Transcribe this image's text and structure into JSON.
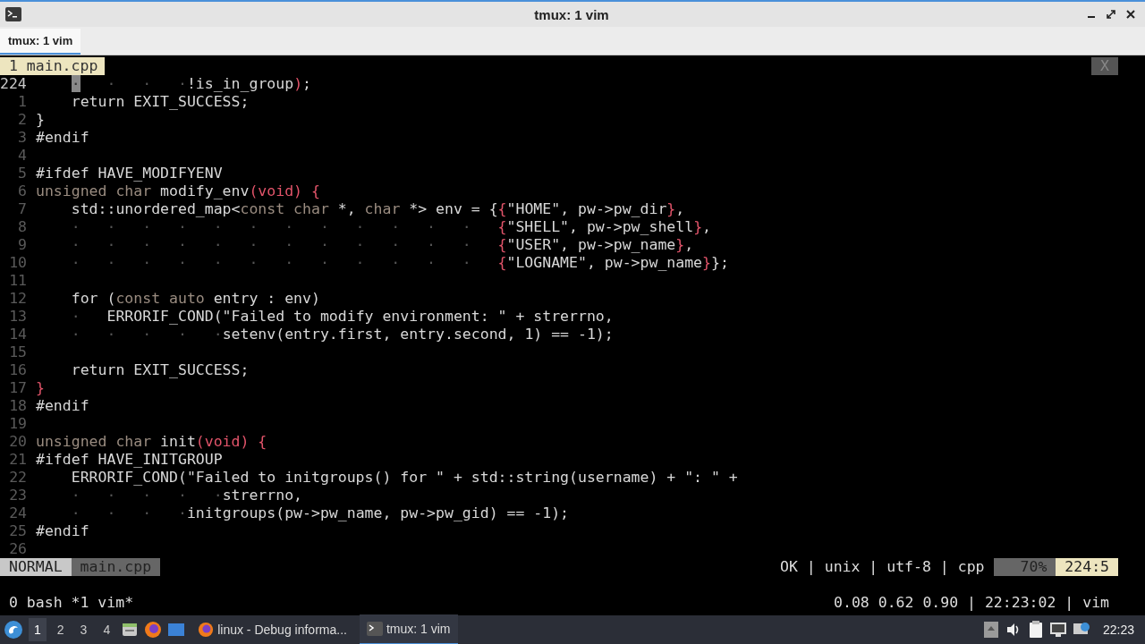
{
  "window": {
    "title": "tmux: 1 vim"
  },
  "tabs": [
    {
      "label": "tmux: 1 vim",
      "selected": true
    }
  ],
  "vim": {
    "tabline": {
      "tabs": [
        {
          "label": "1 main.cpp",
          "selected": true
        }
      ],
      "close": "X"
    },
    "lines": [
      {
        "number": "224",
        "current": true,
        "tokens": [
          {
            "kind": "cursor",
            "text": "    ·"
          },
          {
            "kind": "d",
            "text": "   ·   ·   ·"
          },
          {
            "kind": "n",
            "text": "!is_in_group"
          },
          {
            "kind": "p",
            "text": ")"
          },
          {
            "kind": "n",
            "text": ";"
          }
        ]
      },
      {
        "number": "1",
        "current": false,
        "tokens": [
          {
            "kind": "n",
            "text": "    return EXIT_SUCCESS;"
          }
        ]
      },
      {
        "number": "2",
        "current": false,
        "tokens": [
          {
            "kind": "n",
            "text": "}"
          }
        ]
      },
      {
        "number": "3",
        "current": false,
        "tokens": [
          {
            "kind": "n",
            "text": "#endif"
          }
        ]
      },
      {
        "number": "4",
        "current": false
      },
      {
        "number": "5",
        "current": false,
        "tokens": [
          {
            "kind": "n",
            "text": "#ifdef HAVE_MODIFYENV"
          }
        ]
      },
      {
        "number": "6",
        "current": false,
        "tokens": [
          {
            "kind": "k",
            "text": "unsigned char"
          },
          {
            "kind": "n",
            "text": " modify_env"
          },
          {
            "kind": "p",
            "text": "(void) {"
          }
        ]
      },
      {
        "number": "7",
        "current": false,
        "tokens": [
          {
            "kind": "n",
            "text": "    std::unordered_map<"
          },
          {
            "kind": "k",
            "text": "const char"
          },
          {
            "kind": "n",
            "text": " *, "
          },
          {
            "kind": "k",
            "text": "char"
          },
          {
            "kind": "n",
            "text": " *> env = {"
          },
          {
            "kind": "p",
            "text": "{"
          },
          {
            "kind": "n",
            "text": "\"HOME\", pw->pw_dir"
          },
          {
            "kind": "p",
            "text": "}"
          },
          {
            "kind": "n",
            "text": ","
          }
        ]
      },
      {
        "number": "8",
        "current": false,
        "tokens": [
          {
            "kind": "d",
            "text": "    ·   ·   ·   ·   ·   ·   ·   ·   ·   ·   ·   ·   "
          },
          {
            "kind": "p",
            "text": "{"
          },
          {
            "kind": "n",
            "text": "\"SHELL\", pw->pw_shell"
          },
          {
            "kind": "p",
            "text": "}"
          },
          {
            "kind": "n",
            "text": ","
          }
        ]
      },
      {
        "number": "9",
        "current": false,
        "tokens": [
          {
            "kind": "d",
            "text": "    ·   ·   ·   ·   ·   ·   ·   ·   ·   ·   ·   ·   "
          },
          {
            "kind": "p",
            "text": "{"
          },
          {
            "kind": "n",
            "text": "\"USER\", pw->pw_name"
          },
          {
            "kind": "p",
            "text": "}"
          },
          {
            "kind": "n",
            "text": ","
          }
        ]
      },
      {
        "number": "10",
        "current": false,
        "tokens": [
          {
            "kind": "d",
            "text": "    ·   ·   ·   ·   ·   ·   ·   ·   ·   ·   ·   ·   "
          },
          {
            "kind": "p",
            "text": "{"
          },
          {
            "kind": "n",
            "text": "\"LOGNAME\", pw->pw_name"
          },
          {
            "kind": "p",
            "text": "}"
          },
          {
            "kind": "n",
            "text": "};"
          }
        ]
      },
      {
        "number": "11",
        "current": false
      },
      {
        "number": "12",
        "current": false,
        "tokens": [
          {
            "kind": "n",
            "text": "    for ("
          },
          {
            "kind": "k",
            "text": "const auto"
          },
          {
            "kind": "n",
            "text": " entry : env)"
          }
        ]
      },
      {
        "number": "13",
        "current": false,
        "tokens": [
          {
            "kind": "d",
            "text": "    ·   "
          },
          {
            "kind": "n",
            "text": "ERRORIF_COND(\"Failed to modify environment: \" + strerrno,"
          }
        ]
      },
      {
        "number": "14",
        "current": false,
        "tokens": [
          {
            "kind": "d",
            "text": "    ·   ·   ·   ·   ·"
          },
          {
            "kind": "n",
            "text": "setenv(entry.first, entry.second, 1) == -1);"
          }
        ]
      },
      {
        "number": "15",
        "current": false
      },
      {
        "number": "16",
        "current": false,
        "tokens": [
          {
            "kind": "n",
            "text": "    return EXIT_SUCCESS;"
          }
        ]
      },
      {
        "number": "17",
        "current": false,
        "tokens": [
          {
            "kind": "p",
            "text": "}"
          }
        ]
      },
      {
        "number": "18",
        "current": false,
        "tokens": [
          {
            "kind": "n",
            "text": "#endif"
          }
        ]
      },
      {
        "number": "19",
        "current": false
      },
      {
        "number": "20",
        "current": false,
        "tokens": [
          {
            "kind": "k",
            "text": "unsigned char"
          },
          {
            "kind": "n",
            "text": " init"
          },
          {
            "kind": "p",
            "text": "(void) {"
          }
        ]
      },
      {
        "number": "21",
        "current": false,
        "tokens": [
          {
            "kind": "n",
            "text": "#ifdef HAVE_INITGROUP"
          }
        ]
      },
      {
        "number": "22",
        "current": false,
        "tokens": [
          {
            "kind": "n",
            "text": "    ERRORIF_COND(\"Failed to initgroups() for \" + std::string(username) + \": \" +"
          }
        ]
      },
      {
        "number": "23",
        "current": false,
        "tokens": [
          {
            "kind": "d",
            "text": "    ·   ·   ·   ·   ·"
          },
          {
            "kind": "n",
            "text": "strerrno,"
          }
        ]
      },
      {
        "number": "24",
        "current": false,
        "tokens": [
          {
            "kind": "d",
            "text": "    ·   ·   ·   ·"
          },
          {
            "kind": "n",
            "text": "initgroups(pw->pw_name, pw->pw_gid) == -1);"
          }
        ]
      },
      {
        "number": "25",
        "current": false,
        "tokens": [
          {
            "kind": "n",
            "text": "#endif"
          }
        ]
      },
      {
        "number": "26",
        "current": false
      }
    ],
    "statusline": {
      "mode": "NORMAL",
      "file": "main.cpp",
      "info": "OK | unix | utf-8 | cpp",
      "percent": "70%",
      "position": "224:5"
    }
  },
  "tmux_status": {
    "windows": "0 bash *1 vim*",
    "right": "0.08 0.62 0.90 | 22:23:02 | vim"
  },
  "taskbar": {
    "workspaces": [
      {
        "label": "1",
        "selected": true
      },
      {
        "label": "2",
        "selected": false
      },
      {
        "label": "3",
        "selected": false
      },
      {
        "label": "4",
        "selected": false
      }
    ],
    "tasks": [
      {
        "label": "linux - Debug informa...",
        "kind": "browser",
        "selected": false
      },
      {
        "label": "tmux: 1 vim",
        "kind": "terminal",
        "selected": true
      }
    ],
    "clock": "22:23"
  }
}
